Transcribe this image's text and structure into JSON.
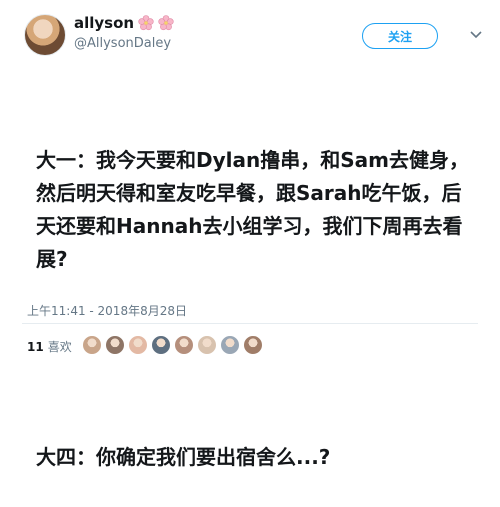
{
  "user": {
    "display_name": "allyson",
    "handle": "@AllysonDaley",
    "name_emojis": [
      "cherry-blossom-icon",
      "cherry-blossom-icon"
    ],
    "follow_label": "关注"
  },
  "tweet": {
    "paragraph1": "大一：我今天要和Dylan撸串，和Sam去健身，然后明天得和室友吃早餐，跟Sarah吃午饭，后天还要和Hannah去小组学习，我们下周再去看展?",
    "paragraph2": "大四：你确定我们要出宿舍么...?",
    "timestamp": "上午11:41 - 2018年8月28日"
  },
  "engagement": {
    "likes_count": "11",
    "likes_label": "喜欢",
    "liker_avatars": 8
  },
  "colors": {
    "accent": "#1da1f2",
    "muted_text": "#657786",
    "divider": "#e6ecf0"
  }
}
